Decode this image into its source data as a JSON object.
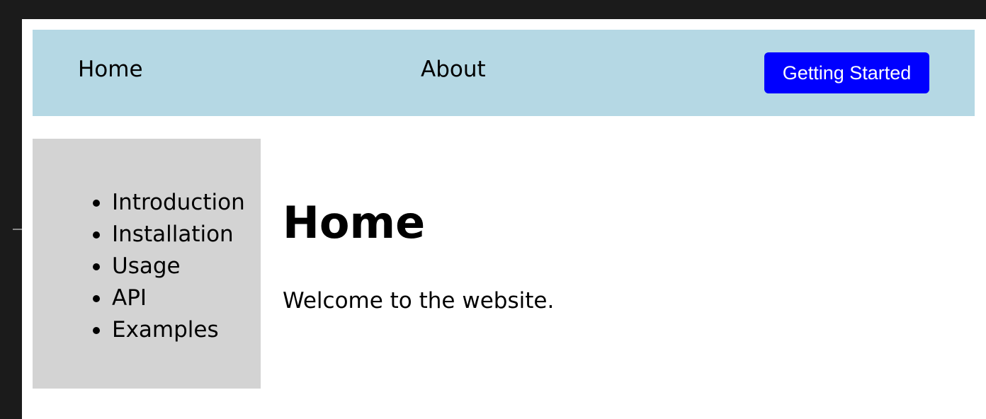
{
  "navbar": {
    "links": [
      {
        "label": "Home"
      },
      {
        "label": "About"
      }
    ],
    "cta_label": "Getting Started"
  },
  "sidebar": {
    "items": [
      {
        "label": "Introduction"
      },
      {
        "label": "Installation"
      },
      {
        "label": "Usage"
      },
      {
        "label": "API"
      },
      {
        "label": "Examples"
      }
    ]
  },
  "main": {
    "title": "Home",
    "body": "Welcome to the website."
  },
  "colors": {
    "navbar_bg": "#b5d8e4",
    "cta_bg": "#0000ff",
    "sidebar_bg": "#d3d3d3",
    "frame_bg": "#1b1b1b"
  }
}
